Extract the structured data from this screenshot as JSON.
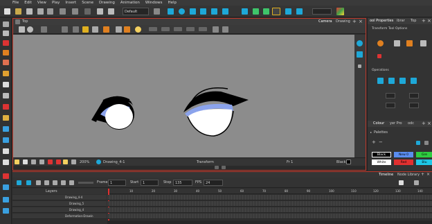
{
  "menu": [
    "File",
    "Edit",
    "View",
    "Play",
    "Insert",
    "Scene",
    "Drawing",
    "Animation",
    "Windows",
    "Help"
  ],
  "toolbar": {
    "workspace": "Default",
    "accent": "#c0392b"
  },
  "view": {
    "title": "Top",
    "tabs": [
      "Camera",
      "Drawing"
    ],
    "status": {
      "zoom": "200%",
      "drawing": "Drawing_4-1",
      "mode": "Transform",
      "frame": "Fr 1",
      "color": "Black"
    }
  },
  "right_panel": {
    "tabs": [
      "ool Properties",
      "ibrar",
      "Top"
    ],
    "sections": [
      "Transform Tool Options",
      "Operations"
    ],
    "color_tabs": [
      "Colour",
      "yer Pro",
      "odc"
    ],
    "palettes_label": "Palettes",
    "swatches": [
      {
        "name": "Black",
        "color": "#000000",
        "text_color": "#ffffff"
      },
      {
        "name": "New 0",
        "color": "#5a8df0",
        "text_color": "#000000"
      },
      {
        "name": "Gre",
        "color": "#2ecc40",
        "text_color": "#000000"
      },
      {
        "name": "White",
        "color": "#ffffff",
        "text_color": "#000000"
      },
      {
        "name": "Red",
        "color": "#e03030",
        "text_color": "#000000"
      },
      {
        "name": "Blu",
        "color": "#1ec8e8",
        "text_color": "#000000"
      }
    ]
  },
  "timeline": {
    "tabs": [
      "Timeline",
      "Node Library"
    ],
    "frame_label": "Frame",
    "frame": "1",
    "start_label": "Start",
    "start": "1",
    "stop_label": "Stop",
    "stop": "135",
    "fps_label": "FPS",
    "fps": "24",
    "layers_header": "Layers",
    "ruler": [
      "10",
      "20",
      "30",
      "40",
      "50",
      "60",
      "70",
      "80",
      "90",
      "100",
      "110",
      "120",
      "130",
      "140"
    ],
    "layers": [
      {
        "name": "Drawing_4-4",
        "selected": false
      },
      {
        "name": "Drawing_5",
        "selected": false
      },
      {
        "name": "Drawing_4",
        "selected": false
      },
      {
        "name": "Deformation-Drawin",
        "selected": false
      }
    ]
  }
}
